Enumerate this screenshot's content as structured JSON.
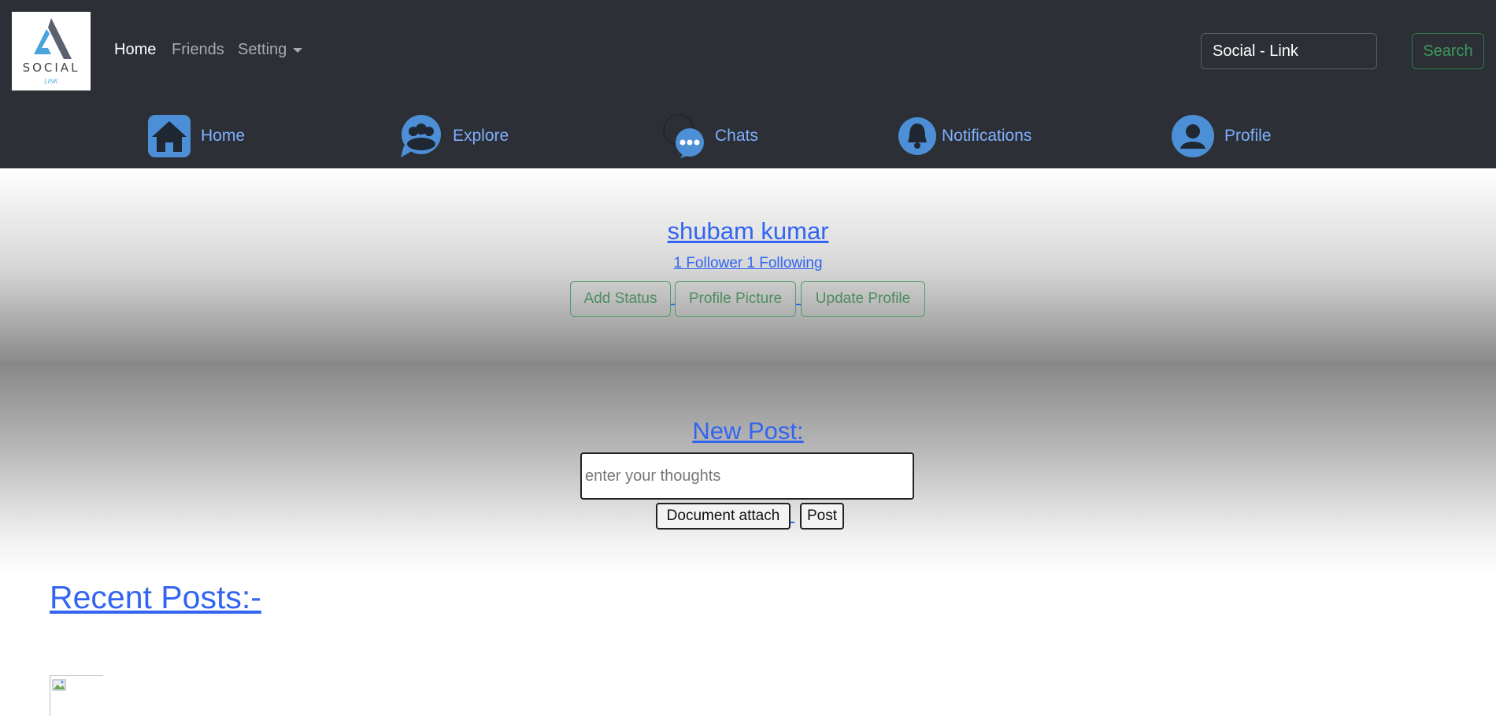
{
  "brand": {
    "wordmark": "SOCIAL",
    "tagline": "LINK"
  },
  "top_nav": {
    "home": "Home",
    "friends": "Friends",
    "setting": "Setting"
  },
  "search": {
    "value": "Social - Link",
    "button": "Search"
  },
  "icon_nav": [
    {
      "label": "Home",
      "icon": "home-icon"
    },
    {
      "label": "Explore",
      "icon": "explore-icon"
    },
    {
      "label": "Chats",
      "icon": "chat-icon"
    },
    {
      "label": "Notifications",
      "icon": "bell-icon"
    },
    {
      "label": "Profile",
      "icon": "user-icon"
    }
  ],
  "profile": {
    "name": "shubam kumar",
    "follow_line": "1 Follower 1 Following",
    "buttons": {
      "add_status": "Add Status",
      "profile_picture": "Profile Picture",
      "update_profile": "Update Profile"
    }
  },
  "new_post": {
    "title": "New Post:",
    "placeholder": "enter your thoughts",
    "document_button": "Document attach",
    "post_button": "Post"
  },
  "recent": {
    "title": "Recent Posts:-"
  },
  "colors": {
    "navbar": "#2c2f35",
    "link": "#3265f2",
    "nav_link": "#7fb0ff",
    "success": "#3c9a5f"
  }
}
